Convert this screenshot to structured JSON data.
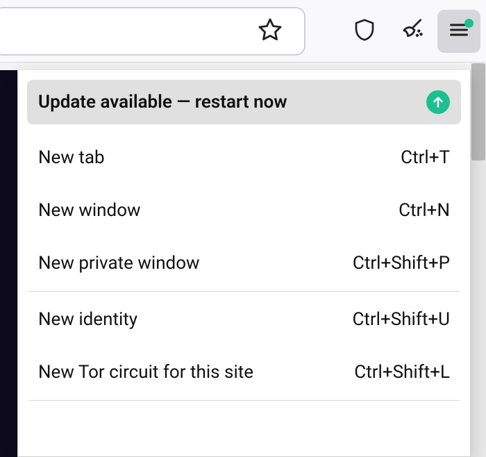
{
  "toolbar": {
    "icons": {
      "star": "bookmark-star",
      "shield": "shield",
      "broom": "broom-sparkle",
      "menu": "hamburger-menu"
    }
  },
  "menu": {
    "update": {
      "label": "Update available — restart now",
      "icon": "arrow-up-circle"
    },
    "groups": [
      [
        {
          "label": "New tab",
          "shortcut": "Ctrl+T"
        },
        {
          "label": "New window",
          "shortcut": "Ctrl+N"
        },
        {
          "label": "New private window",
          "shortcut": "Ctrl+Shift+P"
        }
      ],
      [
        {
          "label": "New identity",
          "shortcut": "Ctrl+Shift+U"
        },
        {
          "label": "New Tor circuit for this site",
          "shortcut": "Ctrl+Shift+L"
        }
      ]
    ]
  }
}
